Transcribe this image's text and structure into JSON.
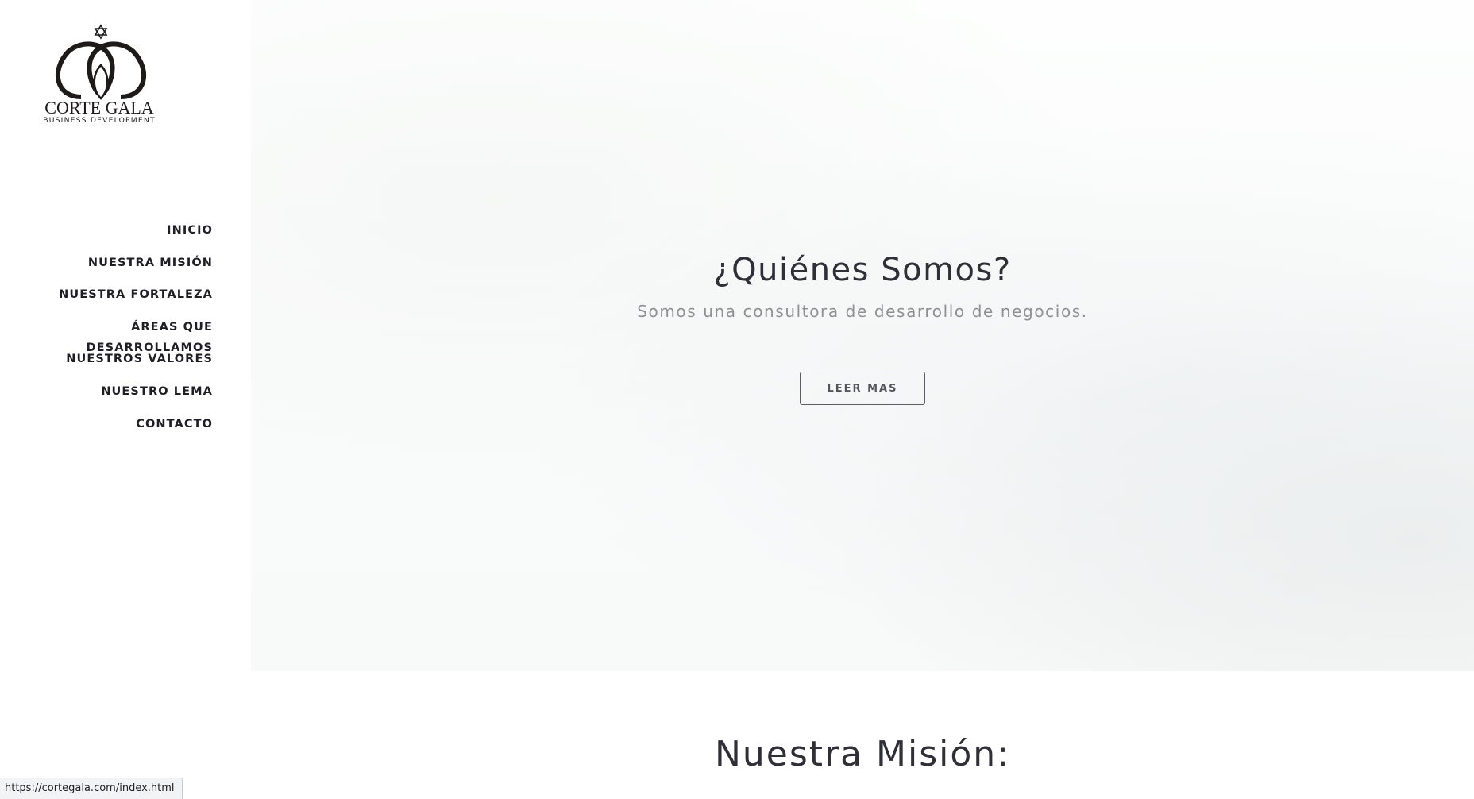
{
  "brand": {
    "name": "CORTE GALA",
    "tagline": "BUSINESS DEVELOPMENT",
    "logo_icon": "interlocked-rings-star-logo"
  },
  "nav": {
    "items": [
      {
        "label": "INICIO"
      },
      {
        "label": "NUESTRA MISIÓN"
      },
      {
        "label": "NUESTRA FORTALEZA"
      },
      {
        "label": "ÁREAS QUE DESARROLLAMOS"
      },
      {
        "label": "NUESTROS VALORES"
      },
      {
        "label": "NUESTRO LEMA"
      },
      {
        "label": "CONTACTO"
      }
    ]
  },
  "hero": {
    "title": "¿Quiénes Somos?",
    "subtitle": "Somos una consultora de desarrollo de negocios.",
    "button_label": "LEER MAS"
  },
  "mission": {
    "title": "Nuestra Misión:"
  },
  "status_bar": {
    "url": "https://cortegala.com/index.html"
  },
  "colors": {
    "text_dark": "#2f2f37",
    "text_muted": "#8f9093",
    "nav_text": "#1e1e24",
    "button_border": "#5d5e63"
  }
}
